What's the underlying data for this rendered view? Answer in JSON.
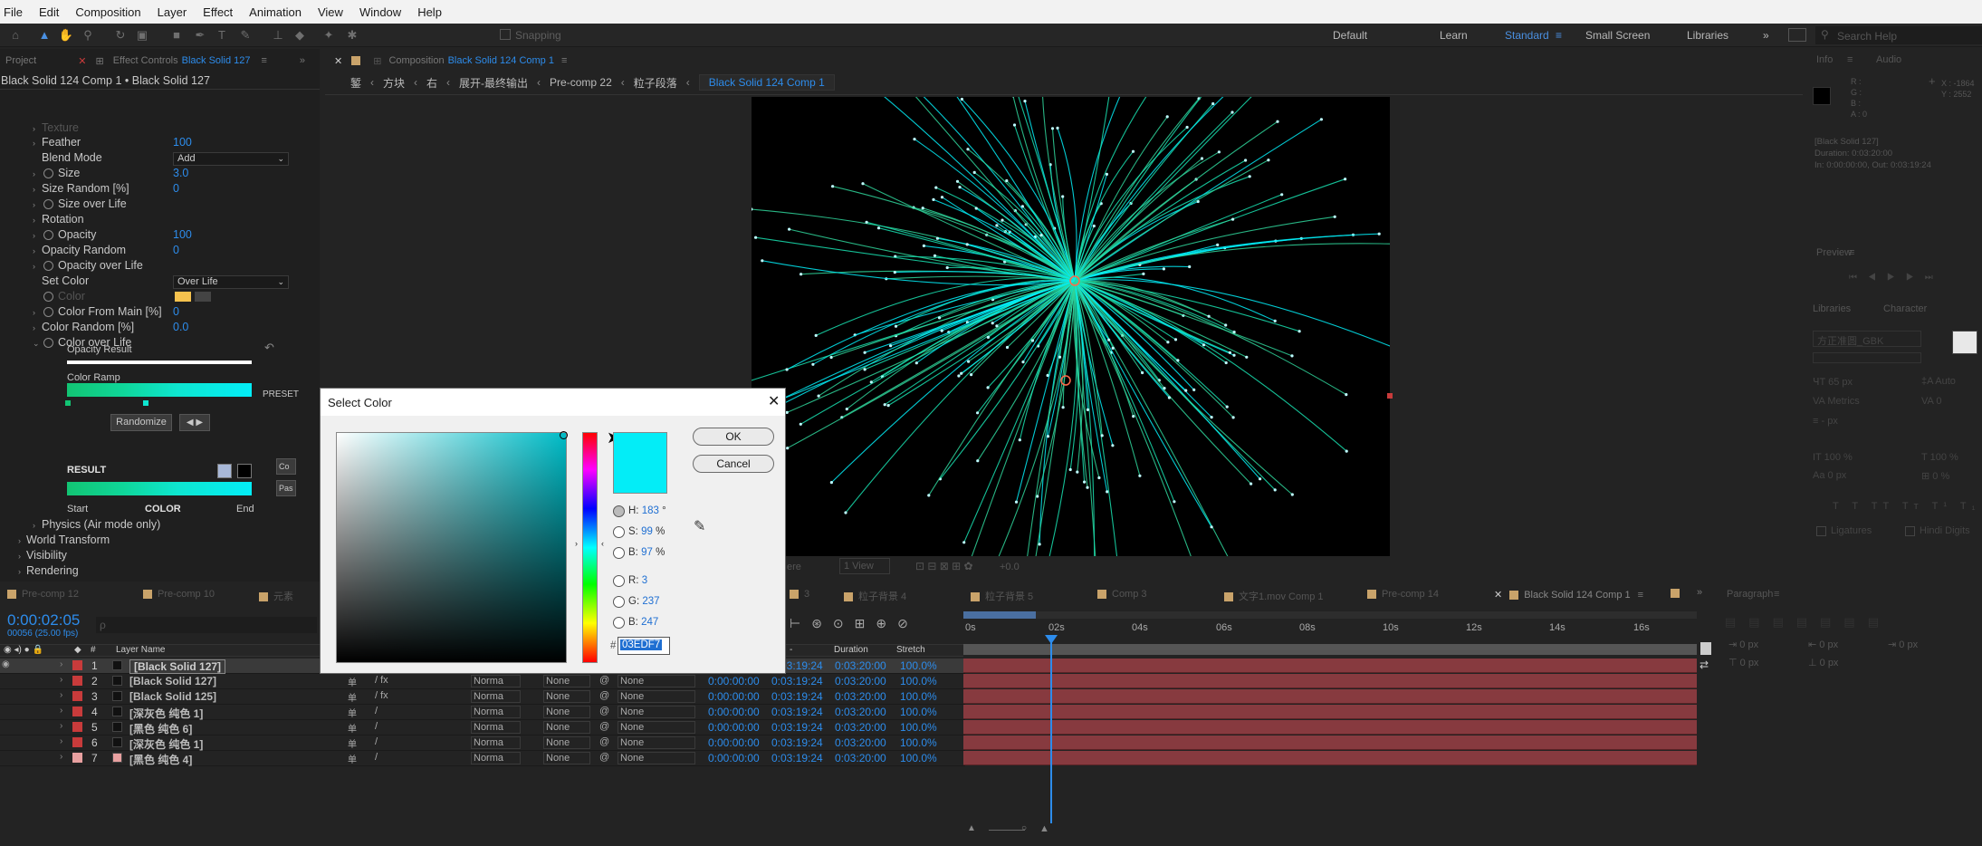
{
  "menu": [
    "File",
    "Edit",
    "Composition",
    "Layer",
    "Effect",
    "Animation",
    "View",
    "Window",
    "Help"
  ],
  "toolbar": {
    "snapping": "Snapping"
  },
  "workspaces": {
    "items": [
      "Default",
      "Learn",
      "Standard",
      "Small Screen",
      "Libraries"
    ],
    "active": "Standard",
    "search_placeholder": "Search Help"
  },
  "left_panel": {
    "tabs": {
      "project": "Project",
      "effect_controls_prefix": "Effect Controls",
      "effect_controls_layer": "Black Solid 127"
    },
    "breadcrumb": "Black Solid 124 Comp 1 • Black Solid 127",
    "props": [
      {
        "name": "Texture",
        "value": ""
      },
      {
        "name": "Feather",
        "value": "100"
      },
      {
        "name": "Blend Mode",
        "value": "Add"
      },
      {
        "name": "Size",
        "value": "3.0"
      },
      {
        "name": "Size Random [%]",
        "value": "0"
      },
      {
        "name": "Size over Life",
        "value": ""
      },
      {
        "name": "Rotation",
        "value": ""
      },
      {
        "name": "Opacity",
        "value": "100"
      },
      {
        "name": "Opacity Random",
        "value": "0"
      },
      {
        "name": "Opacity over Life",
        "value": ""
      },
      {
        "name": "Set Color",
        "value": "Over Life"
      },
      {
        "name": "Color",
        "value": ""
      },
      {
        "name": "Color From Main [%]",
        "value": "0"
      },
      {
        "name": "Color Random [%]",
        "value": "0.0"
      },
      {
        "name": "Color over Life",
        "value": ""
      }
    ],
    "opacity_result": "Opacity Result",
    "color_ramp": "Color Ramp",
    "preset": "PRESET",
    "randomize": "Randomize",
    "result": "RESULT",
    "co_btn": "Co",
    "pas_btn": "Pas",
    "start": "Start",
    "color_label": "COLOR",
    "end": "End",
    "groups": [
      "Physics (Air mode only)",
      "World Transform",
      "Visibility",
      "Rendering"
    ]
  },
  "comp_panel": {
    "tab_prefix": "Composition",
    "tab_name": "Black Solid 124 Comp 1",
    "crumbs": [
      "錾",
      "方块",
      "右",
      "展开-最终输出",
      "Pre-comp 22",
      "粒子段落",
      "Black Solid 124 Comp 1"
    ],
    "view_label": "1 View",
    "quality_label": "ere",
    "exposure": "+0.0"
  },
  "dialog": {
    "title": "Select Color",
    "ok": "OK",
    "cancel": "Cancel",
    "h": {
      "label": "H:",
      "value": "183",
      "unit": "°"
    },
    "s": {
      "label": "S:",
      "value": "99",
      "unit": "%"
    },
    "b": {
      "label": "B:",
      "value": "97",
      "unit": "%"
    },
    "r": {
      "label": "R:",
      "value": "3"
    },
    "g": {
      "label": "G:",
      "value": "237"
    },
    "bb": {
      "label": "B:",
      "value": "247"
    },
    "hex": "03EDF7",
    "hash": "#",
    "color": "#03EDF7"
  },
  "info_panel": {
    "tabs": [
      "Info",
      "Audio"
    ],
    "rgba": [
      "R :",
      "G :",
      "B :",
      "A : 0"
    ],
    "xy": [
      "X : -1864",
      "Y : 2552"
    ],
    "details": [
      "[Black Solid 127]",
      "Duration: 0:03:20:00",
      "In: 0:00:00:00, Out: 0:03:19:24"
    ]
  },
  "preview_panel": {
    "title": "Preview"
  },
  "char_panel": {
    "tabs": [
      "Libraries",
      "Character"
    ],
    "font": "方正准圆_GBK",
    "size": "65 px",
    "auto": "Auto",
    "metrics": "Metrics",
    "tracking": "0",
    "stroke": "- px",
    "vscale": "100 %",
    "hscale": "100 %",
    "baseline": "0 px",
    "tsume": "0 %",
    "ligatures": "Ligatures",
    "hindi": "Hindi Digits"
  },
  "paragraph_panel": {
    "title": "Paragraph",
    "indents": [
      "0 px",
      "0 px",
      "0 px",
      "0 px",
      "0 px"
    ]
  },
  "timeline": {
    "tabs": [
      "Pre-comp 12",
      "Pre-comp 10",
      "元素",
      "3",
      "粒子背景 4",
      "粒子背景 5",
      "Comp 3",
      "文字1.mov Comp 1",
      "Pre-comp 14",
      "Black Solid 124 Comp 1"
    ],
    "timecode": "0:00:02:05",
    "fps": "00056 (25.00 fps)",
    "ruler": [
      "0s",
      "02s",
      "04s",
      "06s",
      "08s",
      "10s",
      "12s",
      "14s",
      "16s"
    ],
    "headers": {
      "layer_name": "Layer Name",
      "duration": "Duration",
      "stretch": "Stretch"
    },
    "layers": [
      {
        "num": "1",
        "name": "[Black Solid 127]",
        "label": "#c83b3b",
        "mode": "Norma",
        "trk": "None",
        "parent": "None",
        "in": "0:00:00:00",
        "out": "0:03:19:24",
        "dur": "0:03:20:00",
        "stretch": "100.0%"
      },
      {
        "num": "2",
        "name": "[Black Solid 127]",
        "label": "#c83b3b",
        "mode": "Norma",
        "trk": "None",
        "parent": "None",
        "in": "0:00:00:00",
        "out": "0:03:19:24",
        "dur": "0:03:20:00",
        "stretch": "100.0%"
      },
      {
        "num": "3",
        "name": "[Black Solid 125]",
        "label": "#c83b3b",
        "mode": "Norma",
        "trk": "None",
        "parent": "None",
        "in": "0:00:00:00",
        "out": "0:03:19:24",
        "dur": "0:03:20:00",
        "stretch": "100.0%"
      },
      {
        "num": "4",
        "name": "[深灰色 纯色 1]",
        "label": "#c83b3b",
        "mode": "Norma",
        "trk": "None",
        "parent": "None",
        "in": "0:00:00:00",
        "out": "0:03:19:24",
        "dur": "0:03:20:00",
        "stretch": "100.0%"
      },
      {
        "num": "5",
        "name": "[黑色 纯色 6]",
        "label": "#c83b3b",
        "mode": "Norma",
        "trk": "None",
        "parent": "None",
        "in": "0:00:00:00",
        "out": "0:03:19:24",
        "dur": "0:03:20:00",
        "stretch": "100.0%"
      },
      {
        "num": "6",
        "name": "[深灰色 纯色 1]",
        "label": "#c83b3b",
        "mode": "Norma",
        "trk": "None",
        "parent": "None",
        "in": "0:00:00:00",
        "out": "0:03:19:24",
        "dur": "0:03:20:00",
        "stretch": "100.0%"
      },
      {
        "num": "7",
        "name": "[黑色 纯色 4]",
        "label": "#e8a0a0",
        "mode": "Norma",
        "trk": "None",
        "parent": "None",
        "in": "0:00:00:00",
        "out": "0:03:19:24",
        "dur": "0:03:20:00",
        "stretch": "100.0%"
      }
    ]
  },
  "colors": {
    "accent": "#2d8ceb",
    "selected_cyan": "#03EDF7",
    "layer_bar": "#873a3f",
    "ramp_start": "#12c473"
  }
}
